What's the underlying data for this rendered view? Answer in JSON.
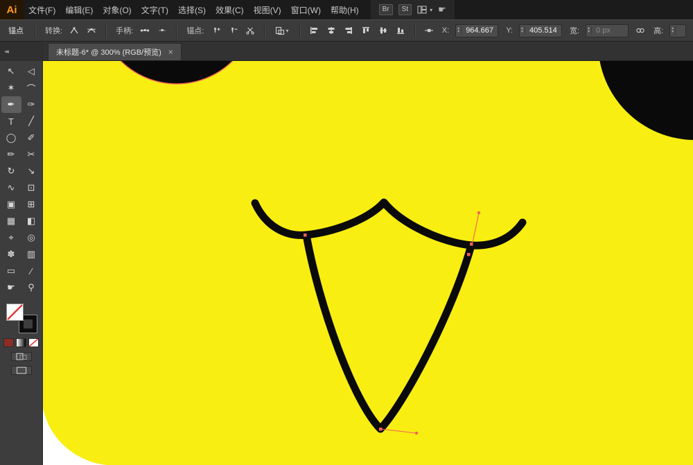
{
  "app": {
    "logo": "Ai"
  },
  "menubar": {
    "items": [
      {
        "label": "文件(F)"
      },
      {
        "label": "编辑(E)"
      },
      {
        "label": "对象(O)"
      },
      {
        "label": "文字(T)"
      },
      {
        "label": "选择(S)"
      },
      {
        "label": "效果(C)"
      },
      {
        "label": "视图(V)"
      },
      {
        "label": "窗口(W)"
      },
      {
        "label": "帮助(H)"
      }
    ],
    "bridge_label": "Br",
    "stock_label": "St",
    "touch_glyph": "☛"
  },
  "control_bar": {
    "mode_label": "锚点",
    "convert_label": "转换:",
    "handles_label": "手柄:",
    "anchors_label": "锚点:",
    "x_label": "X:",
    "x_value": "964.667",
    "y_label": "Y:",
    "y_value": "405.514",
    "width_label": "宽:",
    "width_value": "0 px",
    "height_label": "高:"
  },
  "tab": {
    "title": "未标题-6* @ 300% (RGB/预览)",
    "close_glyph": "×"
  },
  "toolbar": {
    "collapse_glyph": "◂◂",
    "tools": [
      {
        "name": "selection-tool",
        "glyph": "↖"
      },
      {
        "name": "direct-selection-tool",
        "glyph": "◁"
      },
      {
        "name": "magic-wand-tool",
        "glyph": "✶"
      },
      {
        "name": "lasso-tool",
        "glyph": "⌒"
      },
      {
        "name": "pen-tool",
        "glyph": "✒",
        "selected": true
      },
      {
        "name": "curvature-tool",
        "glyph": "✑"
      },
      {
        "name": "type-tool",
        "glyph": "T"
      },
      {
        "name": "line-segment-tool",
        "glyph": "╱"
      },
      {
        "name": "ellipse-tool",
        "glyph": "◯"
      },
      {
        "name": "paintbrush-tool",
        "glyph": "✐"
      },
      {
        "name": "pencil-tool",
        "glyph": "✏"
      },
      {
        "name": "scissors-tool",
        "glyph": "✂"
      },
      {
        "name": "rotate-tool",
        "glyph": "↻"
      },
      {
        "name": "scale-tool",
        "glyph": "↘"
      },
      {
        "name": "width-tool",
        "glyph": "∿"
      },
      {
        "name": "free-transform-tool",
        "glyph": "⊡"
      },
      {
        "name": "shape-builder-tool",
        "glyph": "▣"
      },
      {
        "name": "perspective-grid-tool",
        "glyph": "⊞"
      },
      {
        "name": "mesh-tool",
        "glyph": "▦"
      },
      {
        "name": "gradient-tool",
        "glyph": "◧"
      },
      {
        "name": "eyedropper-tool",
        "glyph": "⌖"
      },
      {
        "name": "blend-tool",
        "glyph": "◎"
      },
      {
        "name": "symbol-sprayer-tool",
        "glyph": "✽"
      },
      {
        "name": "column-graph-tool",
        "glyph": "▥"
      },
      {
        "name": "artboard-tool",
        "glyph": "▭"
      },
      {
        "name": "slice-tool",
        "glyph": "∕"
      },
      {
        "name": "hand-tool",
        "glyph": "☛"
      },
      {
        "name": "zoom-tool",
        "glyph": "⚲"
      }
    ]
  },
  "ui": {
    "caret_down": "▾",
    "spin_up": "▴",
    "spin_down": "▾"
  },
  "colors": {
    "canvas_yellow": "#f8ee12",
    "shape_black": "#0a0a0a",
    "selection_red": "#f4605a",
    "canvas_white": "#ffffff",
    "accent_orange": "#ff9a1e"
  }
}
